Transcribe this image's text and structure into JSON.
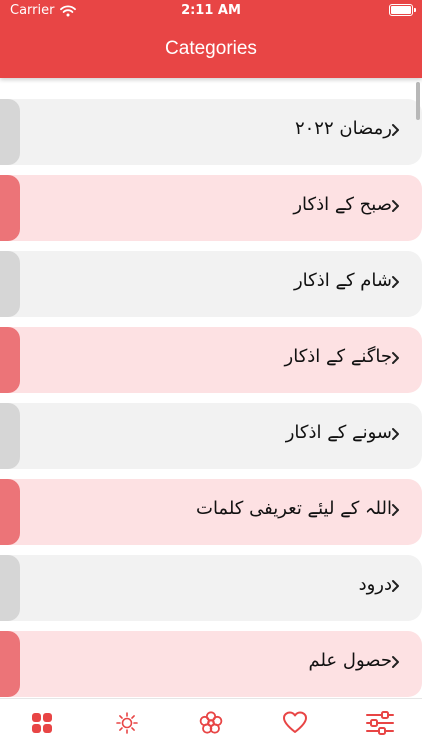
{
  "status": {
    "carrier": "Carrier",
    "time": "2:11 AM"
  },
  "header": {
    "title": "Categories"
  },
  "categories": [
    {
      "label": "رمضان ۲۰۲۲"
    },
    {
      "label": "صبح کے اذکار"
    },
    {
      "label": "شام کے اذکار"
    },
    {
      "label": "جاگنے کے اذکار"
    },
    {
      "label": "سونے کے اذکار"
    },
    {
      "label": "اللہ کے لیئے تعریفی کلمات"
    },
    {
      "label": "درود"
    },
    {
      "label": "حصول علم"
    }
  ],
  "tabbar": {
    "items": [
      "grid-icon",
      "sun-icon",
      "flower-icon",
      "heart-icon",
      "sliders-icon"
    ],
    "active_color": "#e84545"
  },
  "colors": {
    "accent": "#e84545",
    "row_gray": "#f2f2f2",
    "row_pink": "#fde1e3",
    "tab_gray": "#d6d6d6",
    "tab_pink": "#ec7478"
  }
}
